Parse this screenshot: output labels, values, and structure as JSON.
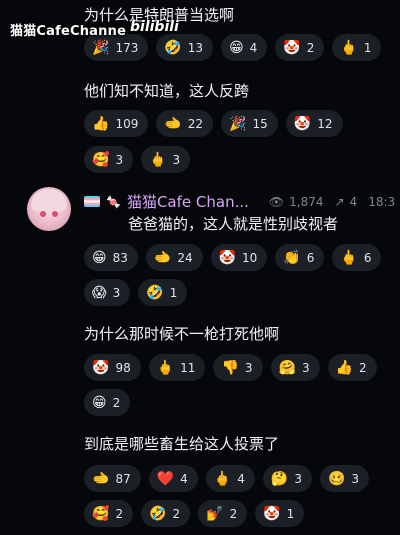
{
  "watermark": {
    "channel": "猫猫CafeChanne",
    "logo": "bilibili"
  },
  "messages": [
    {
      "text": "为什么是特朗普当选啊",
      "reactions": [
        {
          "icon": "party-popper-icon",
          "emoji": "🎉",
          "count": "173"
        },
        {
          "icon": "rolling-laugh-icon",
          "emoji": "🤣",
          "count": "13"
        },
        {
          "icon": "grin-icon",
          "emoji": "😁",
          "count": "4"
        },
        {
          "icon": "clown-icon",
          "emoji": "🤡",
          "count": "2"
        },
        {
          "icon": "middle-finger-icon",
          "emoji": "🖕",
          "count": "1"
        }
      ]
    },
    {
      "text": "他们知不知道，这人反跨",
      "reactions": [
        {
          "icon": "thumbs-up-icon",
          "emoji": "👍",
          "count": "109"
        },
        {
          "icon": "pointing-left-icon",
          "emoji": "🫲",
          "count": "22"
        },
        {
          "icon": "party-popper-icon",
          "emoji": "🎉",
          "count": "15"
        },
        {
          "icon": "clown-icon",
          "emoji": "🤡",
          "count": "12"
        },
        {
          "icon": "smiling-hearts-icon",
          "emoji": "🥰",
          "count": "3"
        },
        {
          "icon": "middle-finger-icon",
          "emoji": "🖕",
          "count": "3"
        }
      ]
    },
    {
      "sender": "猫猫Cafe Chan...",
      "views": "1,874",
      "forwards": "4",
      "time": "18:3",
      "text": "爸爸猫的，这人就是性别歧视者",
      "reactions": [
        {
          "icon": "grin-icon",
          "emoji": "😁",
          "count": "83"
        },
        {
          "icon": "pointing-left-icon",
          "emoji": "🫲",
          "count": "24"
        },
        {
          "icon": "clown-icon",
          "emoji": "🤡",
          "count": "10"
        },
        {
          "icon": "clapping-icon",
          "emoji": "👏",
          "count": "6"
        },
        {
          "icon": "middle-finger-icon",
          "emoji": "🖕",
          "count": "6"
        },
        {
          "icon": "screaming-icon",
          "emoji": "😱",
          "count": "3"
        },
        {
          "icon": "rolling-laugh-icon",
          "emoji": "🤣",
          "count": "1"
        }
      ]
    },
    {
      "text": "为什么那时候不一枪打死他啊",
      "reactions": [
        {
          "icon": "clown-icon",
          "emoji": "🤡",
          "count": "98"
        },
        {
          "icon": "middle-finger-icon",
          "emoji": "🖕",
          "count": "11"
        },
        {
          "icon": "thumbs-down-icon",
          "emoji": "👎",
          "count": "3"
        },
        {
          "icon": "hugging-icon",
          "emoji": "🤗",
          "count": "3"
        },
        {
          "icon": "thumbs-up-icon",
          "emoji": "👍",
          "count": "2"
        },
        {
          "icon": "grin-icon",
          "emoji": "😁",
          "count": "2"
        }
      ]
    },
    {
      "text": "到底是哪些畜生给这人投票了",
      "reactions": [
        {
          "icon": "pointing-left-icon",
          "emoji": "🫲",
          "count": "87"
        },
        {
          "icon": "heart-icon",
          "emoji": "❤️",
          "count": "4"
        },
        {
          "icon": "middle-finger-icon",
          "emoji": "🖕",
          "count": "4"
        },
        {
          "icon": "thinking-icon",
          "emoji": "🤔",
          "count": "3"
        },
        {
          "icon": "woozy-icon",
          "emoji": "🥴",
          "count": "3"
        },
        {
          "icon": "smiling-hearts-icon",
          "emoji": "🥰",
          "count": "2"
        },
        {
          "icon": "rolling-laugh-icon",
          "emoji": "🤣",
          "count": "2"
        },
        {
          "icon": "nail-polish-icon",
          "emoji": "💅",
          "count": "2"
        },
        {
          "icon": "clown-icon",
          "emoji": "🤡",
          "count": "1"
        }
      ]
    }
  ]
}
